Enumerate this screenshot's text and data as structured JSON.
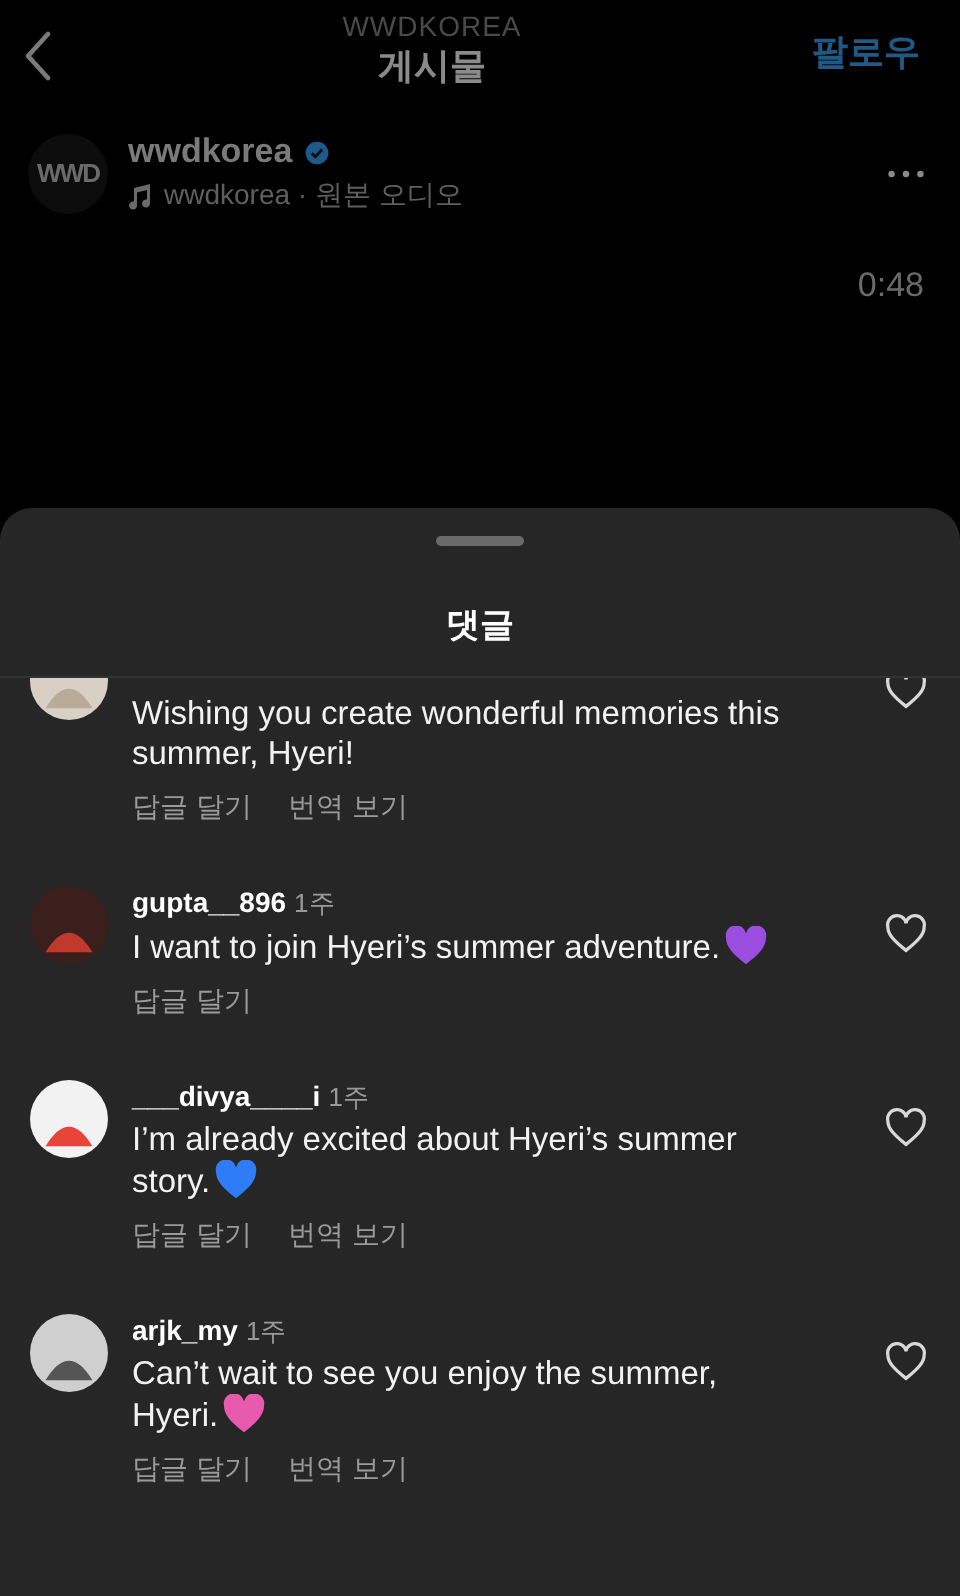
{
  "header": {
    "account_caption": "WWDKOREA",
    "title": "게시물",
    "follow": "팔로우"
  },
  "post": {
    "avatar_text": "WWD",
    "username": "wwdkorea",
    "verified": true,
    "audio": "wwdkorea · 원본 오디오",
    "duration": "0:48"
  },
  "sheet": {
    "title": "댓글"
  },
  "comments": [
    {
      "text": "Wishing you create wonderful memories this summer, Hyeri!",
      "actions": [
        "답글 달기",
        "번역 보기"
      ],
      "liked": false
    },
    {
      "username": "gupta__896",
      "time": "1주",
      "text": "I want to join Hyeri’s summer adventure.",
      "color": "#9b4de0",
      "actions": [
        "답글 달기"
      ],
      "liked": false
    },
    {
      "username": "___divya____i",
      "time": "1주",
      "text": "I’m already excited about Hyeri’s summer story.",
      "color": "#2f7cf6",
      "actions": [
        "답글 달기",
        "번역 보기"
      ],
      "liked": false
    },
    {
      "username": "arjk_my",
      "time": "1주",
      "text": "Can’t wait to see you enjoy the summer, Hyeri.",
      "color": "#e85aae",
      "actions": [
        "답글 달기",
        "번역 보기"
      ],
      "liked": false
    }
  ]
}
